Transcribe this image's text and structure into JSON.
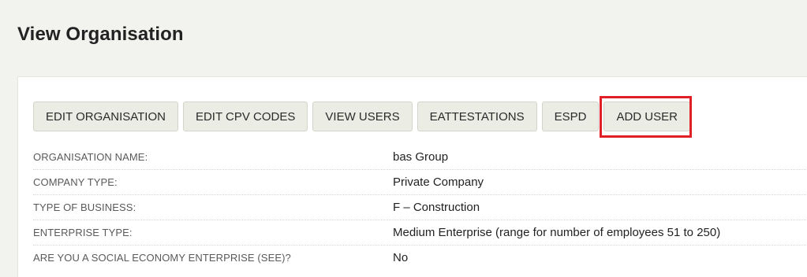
{
  "page": {
    "title": "View Organisation"
  },
  "toolbar": {
    "buttons": [
      {
        "label": "EDIT ORGANISATION"
      },
      {
        "label": "EDIT CPV CODES"
      },
      {
        "label": "VIEW USERS"
      },
      {
        "label": "EATTESTATIONS"
      },
      {
        "label": "ESPD"
      },
      {
        "label": "ADD USER"
      }
    ],
    "highlight_color": "#e01f26"
  },
  "details": {
    "rows": [
      {
        "label": "ORGANISATION NAME:",
        "value": "bas Group"
      },
      {
        "label": "COMPANY TYPE:",
        "value": "Private Company"
      },
      {
        "label": "TYPE OF BUSINESS:",
        "value": "F – Construction"
      },
      {
        "label": "ENTERPRISE TYPE:",
        "value": "Medium Enterprise (range for number of employees 51 to 250)"
      },
      {
        "label": "ARE YOU A SOCIAL ECONOMY ENTERPRISE (SEE)?",
        "value": "No"
      }
    ]
  }
}
